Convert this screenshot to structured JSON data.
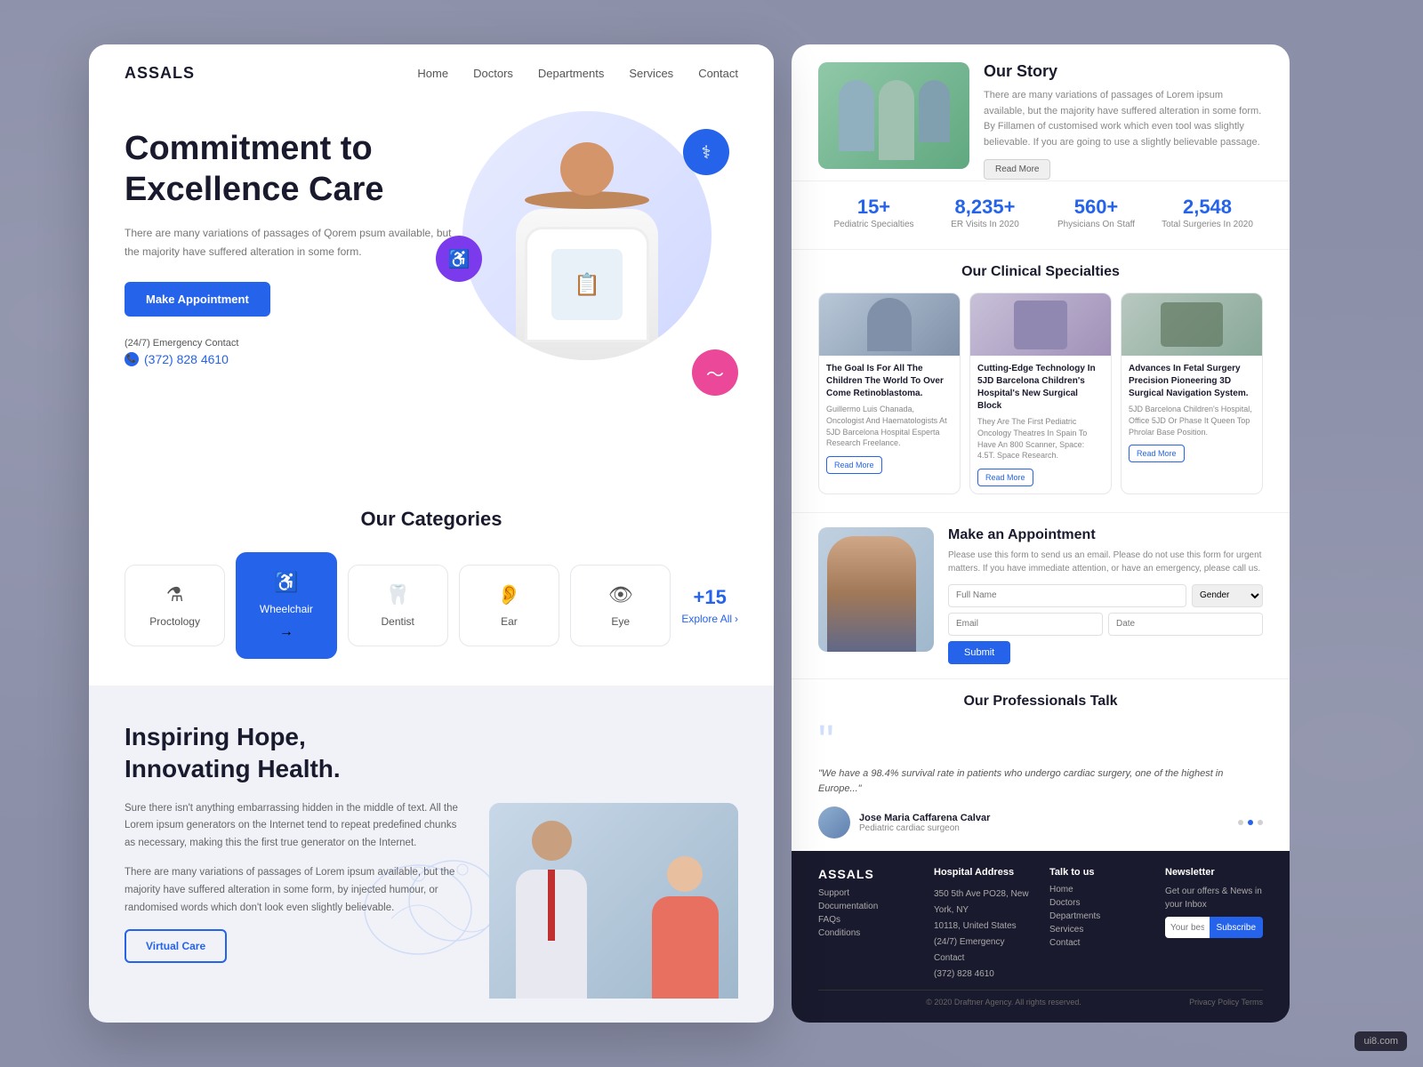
{
  "brand": {
    "logo": "ASSALS"
  },
  "nav": {
    "links": [
      "Home",
      "Doctors",
      "Departments",
      "Services",
      "Contact"
    ]
  },
  "hero": {
    "title_line1": "Commitment to",
    "title_line2": "Excellence Care",
    "description": "There are many variations of passages of Qorem psum available, but the majority have suffered alteration in some form.",
    "cta_label": "Make Appointment",
    "emergency_label": "(24/7) Emergency Contact",
    "phone": "(372) 828 4610"
  },
  "categories": {
    "section_title": "Our Categories",
    "items": [
      {
        "label": "Proctology",
        "icon": "⚗"
      },
      {
        "label": "Wheelchair",
        "icon": "♿",
        "active": true
      },
      {
        "label": "Dentist",
        "icon": "🦷"
      },
      {
        "label": "Ear",
        "icon": "👂"
      },
      {
        "label": "Eye",
        "icon": "👁"
      }
    ],
    "explore_num": "+15",
    "explore_label": "Explore All"
  },
  "bottom_section": {
    "title_line1": "Inspiring Hope,",
    "title_line2": "Innovating Health.",
    "desc1": "Sure there isn't anything embarrassing hidden in the middle of text. All the Lorem ipsum generators on the Internet tend to repeat predefined chunks as necessary, making this the first true generator on the Internet.",
    "desc2": "There are many variations of passages of Lorem ipsum available, but the majority have suffered alteration in some form, by injected humour, or randomised words which don't look even slightly believable.",
    "cta_label": "Virtual Care"
  },
  "right": {
    "our_story": {
      "title": "Our Story",
      "text": "There are many variations of passages of Lorem ipsum available, but the majority have suffered alteration in some form. By Fillamen of customised work which even tool was slightly believable. If you are going to use a slightly believable passage.",
      "read_more": "Read More"
    },
    "stats": [
      {
        "num": "15+",
        "label": "Pediatric Specialties"
      },
      {
        "num": "8,235+",
        "label": "ER Visits In 2020"
      },
      {
        "num": "560+",
        "label": "Physicians On Staff"
      },
      {
        "num": "2,548",
        "label": "Total Surgeries In 2020"
      }
    ],
    "clinical_specialties": {
      "title": "Our Clinical Specialties",
      "cards": [
        {
          "title": "The Goal Is For All The Children The World To Over Come Retinoblastoma.",
          "text": "Guillermo Luis Chanada, Oncologist And Haematologists At 5JD Barcelona Hospital Esperta Research Freelance.",
          "btn": "Read More"
        },
        {
          "title": "Cutting-Edge Technology In 5JD Barcelona Children's Hospital's New Surgical Block",
          "text": "They Are The First Pediatric Oncology Theatres In Spain To Have An 800 Scanner, Space: 4.5T. Space Research.",
          "btn": "Read More"
        },
        {
          "title": "Advances In Fetal Surgery Precision Pioneering 3D Surgical Navigation System.",
          "text": "5JD Barcelona Children's Hospital, Office 5JD Or Phase It Queen Top Phrolar Base Position.",
          "btn": "Read More"
        }
      ]
    },
    "appointment": {
      "title": "Make an Appointment",
      "desc": "Please use this form to send us an email. Please do not use this form for urgent matters. If you have immediate attention, or have an emergency, please call us.",
      "form": {
        "full_name_placeholder": "Full Name",
        "gender_label": "Gender",
        "email_placeholder": "Email",
        "date_placeholder": "Date",
        "submit_label": "Submit"
      }
    },
    "testimonial": {
      "title": "Our Professionals Talk",
      "quote": "\"We have a 98.4% survival rate in patients who undergo cardiac surgery, one of the highest in Europe...\"",
      "author_name": "Jose Maria Caffarena Calvar",
      "author_title": "Pediatric cardiac surgeon"
    },
    "footer": {
      "logo": "ASSALS",
      "cols": [
        {
          "title": "",
          "items": [
            "Support",
            "Documentation",
            "FAQs",
            "Conditions"
          ]
        },
        {
          "title": "Hospital Address",
          "items": [
            "350 5th Ave PO28, New York, NY",
            "10118, United States",
            "(24/7) Emergency Contact",
            "(372) 828 4610"
          ]
        },
        {
          "title": "Talk to us",
          "items": [
            "Home",
            "Doctors",
            "Departments",
            "Services",
            "Contact"
          ]
        },
        {
          "title": "Newsletter",
          "desc": "Get our offers & News in your Inbox",
          "input_placeholder": "Your best Email",
          "subscribe_label": "Subscribe"
        }
      ],
      "copyright": "© 2020 Draftner Agency. All rights reserved.",
      "privacy": "Privacy Policy    Terms"
    }
  }
}
